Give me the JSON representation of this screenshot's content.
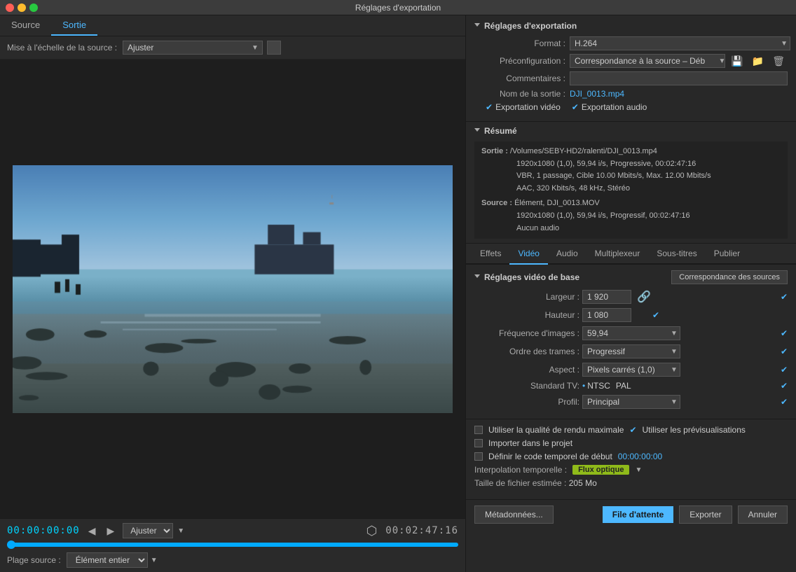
{
  "window": {
    "title": "Réglages d'exportation"
  },
  "left": {
    "tabs": [
      {
        "label": "Source",
        "active": false
      },
      {
        "label": "Sortie",
        "active": true
      }
    ],
    "scale_label": "Mise à l'échelle de la source :",
    "scale_value": "Ajuster",
    "timecode_start": "00:00:00:00",
    "timecode_end": "00:02:47:16",
    "fit_label": "Ajuster",
    "source_label": "Plage source :",
    "source_value": "Élément entier"
  },
  "right": {
    "export_section_title": "Réglages d'exportation",
    "format_label": "Format :",
    "format_value": "H.264",
    "preconfig_label": "Préconfiguration :",
    "preconfig_value": "Correspondance à la source – Déb",
    "comments_label": "Commentaires :",
    "output_name_label": "Nom de la sortie :",
    "output_name_value": "DJI_0013.mp4",
    "export_video_label": "Exportation vidéo",
    "export_audio_label": "Exportation audio",
    "summary_title": "Résumé",
    "summary_output_label": "Sortie :",
    "summary_output_path": "/Volumes/SEBY-HD2/ralenti/DJI_0013.mp4",
    "summary_output_detail1": "1920x1080 (1,0), 59,94 i/s, Progressive, 00:02:47:16",
    "summary_output_detail2": "VBR, 1 passage, Cible 10.00  Mbits/s, Max. 12.00  Mbits/s",
    "summary_output_detail3": "AAC, 320  Kbits/s, 48  kHz, Stéréo",
    "summary_source_label": "Source :",
    "summary_source_name": "Élément, DJI_0013.MOV",
    "summary_source_detail1": "1920x1080 (1,0), 59,94  i/s, Progressif, 00:02:47:16",
    "summary_source_detail2": "Aucun audio",
    "settings_tabs": [
      {
        "label": "Effets",
        "active": false
      },
      {
        "label": "Vidéo",
        "active": true
      },
      {
        "label": "Audio",
        "active": false
      },
      {
        "label": "Multiplexeur",
        "active": false
      },
      {
        "label": "Sous-titres",
        "active": false
      },
      {
        "label": "Publier",
        "active": false
      }
    ],
    "video_section_title": "Réglages vidéo de base",
    "correspondence_btn": "Correspondance des sources",
    "width_label": "Largeur :",
    "width_value": "1 920",
    "height_label": "Hauteur :",
    "height_value": "1 080",
    "framerate_label": "Fréquence d'images :",
    "framerate_value": "59,94",
    "field_order_label": "Ordre des trames :",
    "field_order_value": "Progressif",
    "aspect_label": "Aspect :",
    "aspect_value": "Pixels carrés (1,0)",
    "tv_standard_label": "Standard TV:",
    "tv_ntsc": "NTSC",
    "tv_pal": "PAL",
    "profile_label": "Profil:",
    "profile_value": "Principal",
    "options": {
      "max_render": "Utiliser la qualité de rendu maximale",
      "use_previews_check": true,
      "use_previews": "Utiliser les prévisualisations",
      "import_project": "Importer dans le projet",
      "set_timecode": "Définir le code temporel de début",
      "timecode_val": "00:00:00:00"
    },
    "interpolation_label": "Interpolation temporelle :",
    "interpolation_value": "Flux optique",
    "filesize_label": "Taille de fichier estimée :",
    "filesize_value": "205 Mo",
    "buttons": {
      "metadata": "Métadonnées...",
      "queue": "File d'attente",
      "export": "Exporter",
      "cancel": "Annuler"
    }
  }
}
